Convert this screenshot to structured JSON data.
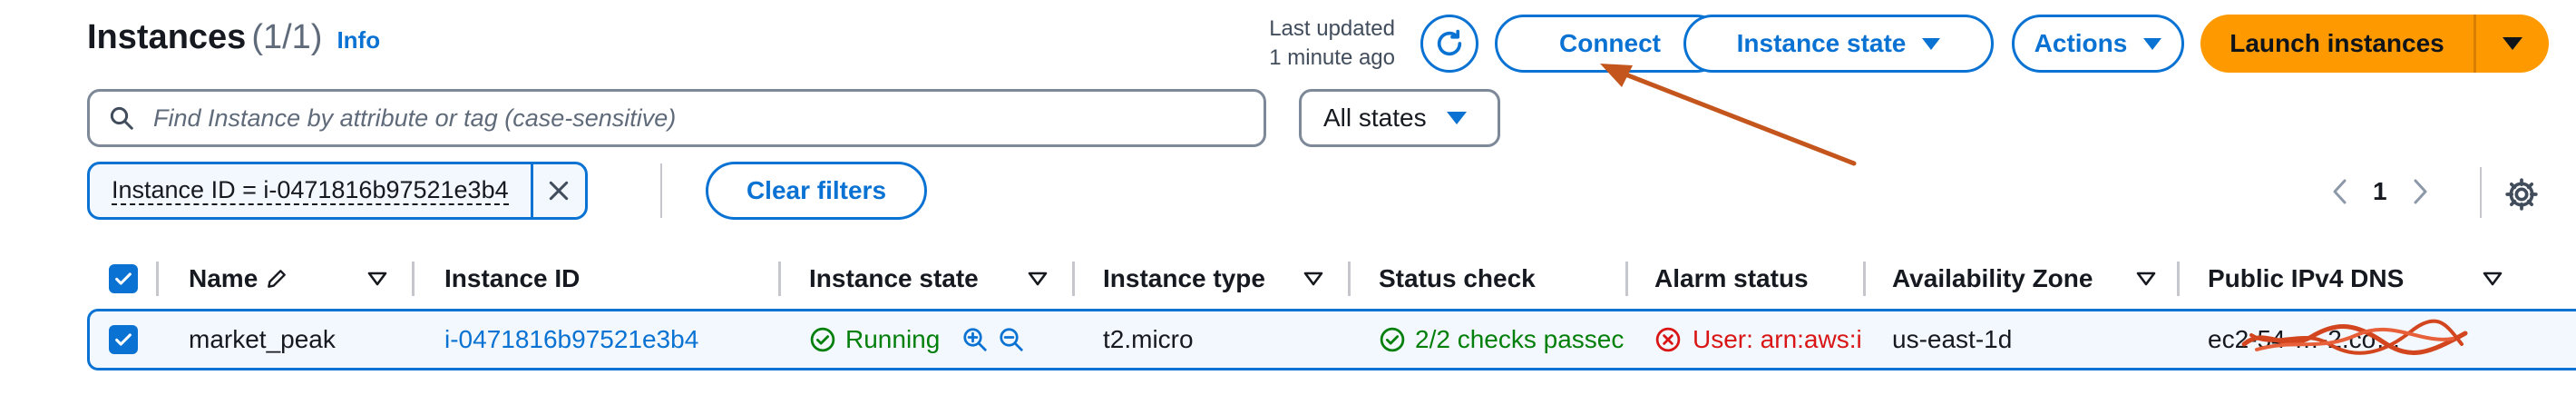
{
  "header": {
    "title": "Instances",
    "count": "(1/1)",
    "info_link": "Info",
    "last_updated_line1": "Last updated",
    "last_updated_line2": "1 minute ago"
  },
  "toolbar": {
    "connect_label": "Connect",
    "instance_state_label": "Instance state",
    "actions_label": "Actions",
    "launch_label": "Launch instances"
  },
  "search": {
    "placeholder": "Find Instance by attribute or tag (case-sensitive)"
  },
  "state_filter": {
    "selected": "All states"
  },
  "filter_token": {
    "label": "Instance ID = i-0471816b97521e3b4"
  },
  "clear_filters_label": "Clear filters",
  "pagination": {
    "current_page": "1"
  },
  "table": {
    "columns": [
      "Name",
      "Instance ID",
      "Instance state",
      "Instance type",
      "Status check",
      "Alarm status",
      "Availability Zone",
      "Public IPv4 DNS"
    ],
    "rows": [
      {
        "name": "market_peak",
        "instance_id": "i-0471816b97521e3b4",
        "state": "Running",
        "type": "t2.micro",
        "status_check": "2/2 checks passec",
        "alarm_status": "User: arn:aws:i",
        "availability_zone": "us-east-1d",
        "public_dns": "ec2-54-…-2.co…"
      }
    ]
  },
  "colors": {
    "accent": "#0972d3",
    "primary_button": "#ff9900",
    "success": "#037f0c",
    "error": "#d91515",
    "annotation_arrow": "#c4551c"
  }
}
